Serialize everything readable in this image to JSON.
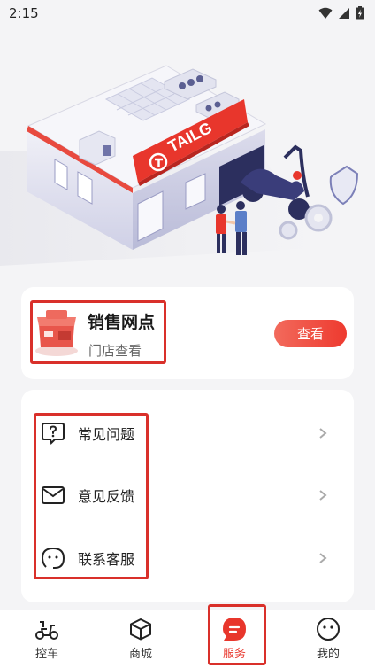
{
  "status_bar": {
    "time": "2:15"
  },
  "hero": {
    "brand_sign": "TAILG"
  },
  "store": {
    "title": "销售网点",
    "subtitle": "门店查看",
    "view_button": "查看"
  },
  "menu": {
    "items": [
      {
        "label": "常见问题",
        "icon": "question-bubble-icon"
      },
      {
        "label": "意见反馈",
        "icon": "mail-icon"
      },
      {
        "label": "联系客服",
        "icon": "customer-service-icon"
      }
    ]
  },
  "nav": {
    "items": [
      {
        "label": "控车",
        "icon": "scooter-icon"
      },
      {
        "label": "商城",
        "icon": "cube-icon"
      },
      {
        "label": "服务",
        "icon": "service-chat-icon",
        "active": true
      },
      {
        "label": "我的",
        "icon": "smiley-icon"
      }
    ]
  },
  "colors": {
    "accent": "#e8362c",
    "background": "#f4f4f6",
    "card": "#ffffff"
  }
}
